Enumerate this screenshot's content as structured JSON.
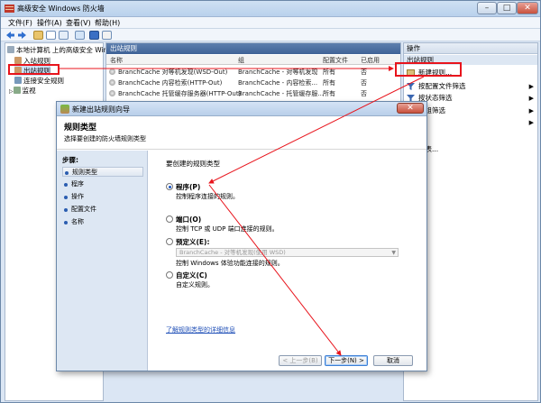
{
  "window": {
    "title": "高级安全 Windows 防火墙",
    "controls": {
      "minimize": "–",
      "maximize": "□",
      "close": "✕"
    }
  },
  "menu": [
    "文件(F)",
    "操作(A)",
    "查看(V)",
    "帮助(H)"
  ],
  "tree": {
    "root": "本地计算机 上的高级安全 Win",
    "items": [
      "入站规则",
      "出站规则",
      "连接安全规则",
      "监视"
    ]
  },
  "list": {
    "title": "出站规则",
    "columns": [
      "名称",
      "组",
      "配置文件",
      "已启用"
    ],
    "rows": [
      {
        "name": "BranchCache 对等机发现(WSD-Out)",
        "group": "BranchCache - 对等机发现",
        "profile": "所有",
        "enabled": "否"
      },
      {
        "name": "BranchCache 内容检索(HTTP-Out)",
        "group": "BranchCache - 内容检索...",
        "profile": "所有",
        "enabled": "否"
      },
      {
        "name": "BranchCache 托管缓存服务器(HTTP-Out)",
        "group": "BranchCache - 托管缓存服...",
        "profile": "所有",
        "enabled": "否"
      }
    ]
  },
  "actions": {
    "title": "操作",
    "section": "出站规则",
    "items": [
      "新建规则...",
      "按配置文件筛选",
      "按状态筛选",
      "按组筛选",
      "",
      "列表..."
    ]
  },
  "wizard": {
    "title": "新建出站规则向导",
    "close": "✕",
    "heading": "规则类型",
    "subheading": "选择要创建的防火墙规则类型",
    "steps_label": "步骤:",
    "steps": [
      "规则类型",
      "程序",
      "操作",
      "配置文件",
      "名称"
    ],
    "question": "要创建的规则类型",
    "options": [
      {
        "label": "程序(P)",
        "desc": "控制程序连接的规则。"
      },
      {
        "label": "端口(O)",
        "desc": "控制 TCP 或 UDP 端口连接的规则。"
      },
      {
        "label": "预定义(E):",
        "desc": "控制 Windows 体验功能连接的规则。"
      },
      {
        "label": "自定义(C)",
        "desc": "自定义规则。"
      }
    ],
    "predefined_value": "BranchCache - 对等机发现(使用 WSD)",
    "learn_more": "了解规则类型的详细信息",
    "buttons": {
      "prev": "< 上一步(B)",
      "next": "下一步(N) >",
      "cancel": "取消"
    }
  },
  "colors": {
    "annotation": "#e8141c",
    "link": "#1f4fb7",
    "header": "#3f6296"
  }
}
